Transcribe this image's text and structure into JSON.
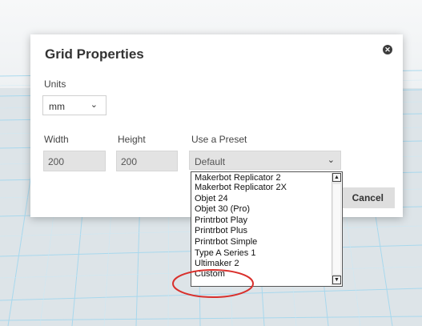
{
  "dialog": {
    "title": "Grid Properties",
    "close_icon": "close-icon",
    "units_label": "Units",
    "units_value": "mm",
    "width_label": "Width",
    "height_label": "Height",
    "preset_label": "Use a Preset",
    "width_value": "200",
    "height_value": "200",
    "preset_value": "Default",
    "cancel_label": "Cancel"
  },
  "preset_dropdown": {
    "options": [
      "Makerbot Replicator 2",
      "Makerbot Replicator 2X",
      "Objet 24",
      "Objet 30 (Pro)",
      "Printrbot Play",
      "Printrbot Plus",
      "Printrbot Simple",
      "Type A Series 1",
      "Ultimaker 2",
      "Custom"
    ],
    "highlighted": "Custom"
  },
  "colors": {
    "annotation": "#d9302c",
    "grid_line": "#8fd0ea",
    "dialog_bg": "#ffffff"
  }
}
